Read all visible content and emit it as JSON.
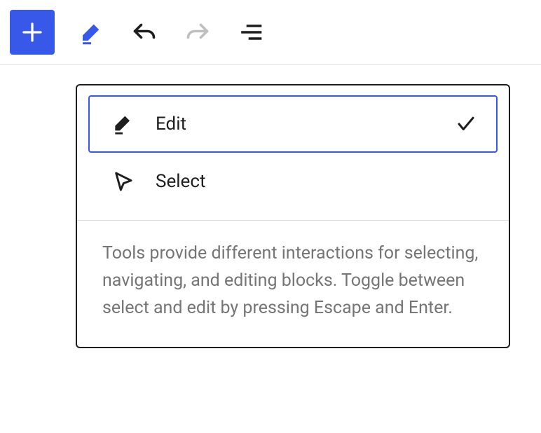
{
  "toolbar": {
    "add_label": "Add block",
    "tools_label": "Tools",
    "undo_label": "Undo",
    "redo_label": "Redo",
    "details_label": "Details"
  },
  "dropdown": {
    "items": [
      {
        "label": "Edit",
        "selected": true
      },
      {
        "label": "Select",
        "selected": false
      }
    ],
    "help": "Tools provide different interactions for selecting, navigating, and editing blocks. Toggle between select and edit by pressing Escape and Enter."
  }
}
